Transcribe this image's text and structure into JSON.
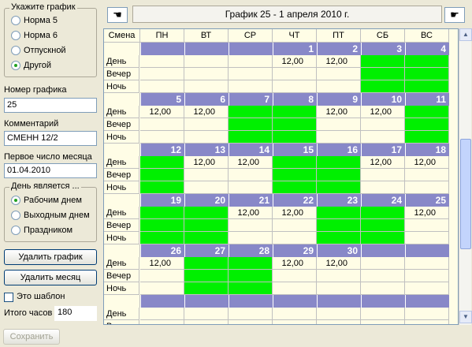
{
  "left": {
    "group_title": "Укажите график",
    "schedule_options": [
      "Норма 5",
      "Норма 6",
      "Отпускной",
      "Другой"
    ],
    "schedule_selected": 3,
    "number_label": "Номер графика",
    "number_value": "25",
    "comment_label": "Комментарий",
    "comment_value": "СМЕНН 12/2",
    "first_day_label": "Первое число месяца",
    "first_day_value": "01.04.2010",
    "day_group_title": "День является ...",
    "day_options": [
      "Рабочим днем",
      "Выходным днем",
      "Праздником"
    ],
    "day_selected": 0,
    "delete_schedule": "Удалить график",
    "delete_month": "Удалить месяц",
    "template_label": "Это шаблон",
    "total_label": "Итого часов",
    "total_value": "180",
    "save_label": "Сохранить"
  },
  "header": {
    "title": "График 25 - 1 апреля 2010 г.",
    "prev_icon": "hand-pointing-left-icon",
    "next_icon": "hand-pointing-right-icon"
  },
  "grid": {
    "shift_header": "Смена",
    "weekdays": [
      "ПН",
      "ВТ",
      "СР",
      "ЧТ",
      "ПТ",
      "СБ",
      "ВС"
    ],
    "shifts": [
      "День",
      "Вечер",
      "Ночь"
    ],
    "hours_value": "12,00",
    "weeks": [
      {
        "days": [
          "",
          "",
          "",
          "1",
          "2",
          "3",
          "4"
        ],
        "cells": [
          [
            "",
            "",
            "",
            "h",
            "h",
            "g",
            "g"
          ],
          [
            "",
            "",
            "",
            "",
            "",
            "g",
            "g"
          ],
          [
            "",
            "",
            "",
            "",
            "",
            "g",
            "g"
          ]
        ]
      },
      {
        "days": [
          "5",
          "6",
          "7",
          "8",
          "9",
          "10",
          "11"
        ],
        "cells": [
          [
            "h",
            "h",
            "g",
            "g",
            "h",
            "h",
            "g"
          ],
          [
            "",
            "",
            "g",
            "g",
            "",
            "",
            "g"
          ],
          [
            "",
            "",
            "g",
            "g",
            "",
            "",
            "g"
          ]
        ]
      },
      {
        "days": [
          "12",
          "13",
          "14",
          "15",
          "16",
          "17",
          "18"
        ],
        "cells": [
          [
            "g",
            "h",
            "h",
            "g",
            "g",
            "h",
            "h"
          ],
          [
            "g",
            "",
            "",
            "g",
            "g",
            "",
            ""
          ],
          [
            "g",
            "",
            "",
            "g",
            "g",
            "",
            ""
          ]
        ]
      },
      {
        "days": [
          "19",
          "20",
          "21",
          "22",
          "23",
          "24",
          "25"
        ],
        "cells": [
          [
            "g",
            "g",
            "h",
            "h",
            "g",
            "g",
            "h"
          ],
          [
            "g",
            "g",
            "",
            "",
            "g",
            "g",
            ""
          ],
          [
            "g",
            "g",
            "",
            "",
            "g",
            "g",
            ""
          ]
        ]
      },
      {
        "days": [
          "26",
          "27",
          "28",
          "29",
          "30",
          "",
          ""
        ],
        "cells": [
          [
            "h",
            "g",
            "g",
            "h",
            "h",
            "",
            ""
          ],
          [
            "",
            "g",
            "g",
            "",
            "",
            "",
            ""
          ],
          [
            "",
            "g",
            "g",
            "",
            "",
            "",
            ""
          ]
        ]
      },
      {
        "days": [
          "",
          "",
          "",
          "",
          "",
          "",
          ""
        ],
        "cells": [
          [
            "",
            "",
            "",
            "",
            "",
            "",
            ""
          ],
          [
            "",
            "",
            "",
            "",
            "",
            "",
            ""
          ],
          [
            "",
            "",
            "",
            "",
            "",
            "",
            ""
          ]
        ]
      }
    ]
  },
  "colors": {
    "work": "#00f000",
    "week_bar": "#8888c8",
    "cell_bg": "#fffde6"
  }
}
